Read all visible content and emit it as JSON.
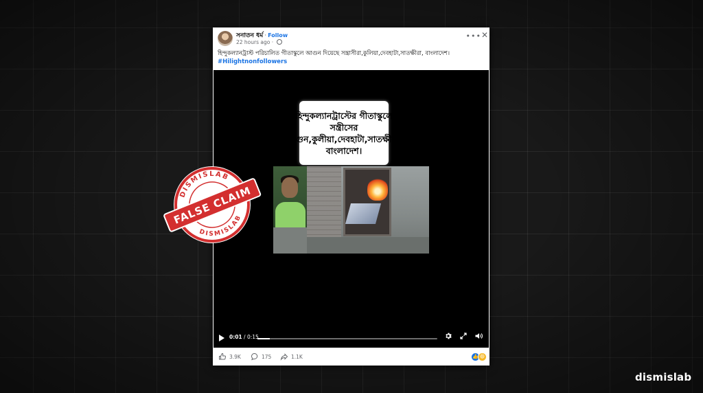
{
  "post": {
    "author": "সনাতন ধর্ম",
    "separator": "·",
    "follow_label": "Follow",
    "timestamp": "22 hours ago",
    "timestamp_separator": "·",
    "more_icon": "more-options-icon",
    "close_icon": "close-icon",
    "caption": "হিন্দুকল্যানট্রাস্ট পরিচালিত গীতাস্কুলে আগুন দিয়েছে সন্ত্রাসীরা,কুলিয়া,দেবহাটা,সাতক্ষীরা, বাংলাদেশ।",
    "hashtag": "#Hilightnonfollowers"
  },
  "video": {
    "overlay_text": "হিন্দুকল্যানট্রাস্টের গীতাস্কুলে সন্ত্রীসের আগুন,কুলীয়া,দেবহাটা,সাতক্ষীরা, বাংলাদেশ।",
    "time_current": "0:01",
    "time_sep": " / ",
    "time_total": "0:15",
    "progress": 0.067,
    "play_icon": "play-icon",
    "settings_icon": "gear-icon",
    "fullscreen_icon": "expand-icon",
    "volume_icon": "volume-icon"
  },
  "actions": {
    "likes": "3.9K",
    "comments": "175",
    "shares": "1.1K",
    "reaction_icons": [
      "like-reaction",
      "haha-reaction"
    ]
  },
  "stamp": {
    "top_text": "DISMISLAB",
    "bottom_text": "DISMISLAB",
    "center_text": "FALSE CLAIM",
    "color": "#d32f2f"
  },
  "brand": {
    "logo_text": "dismislab"
  },
  "colors": {
    "facebook_blue": "#1b74e4",
    "background": "#191919"
  }
}
